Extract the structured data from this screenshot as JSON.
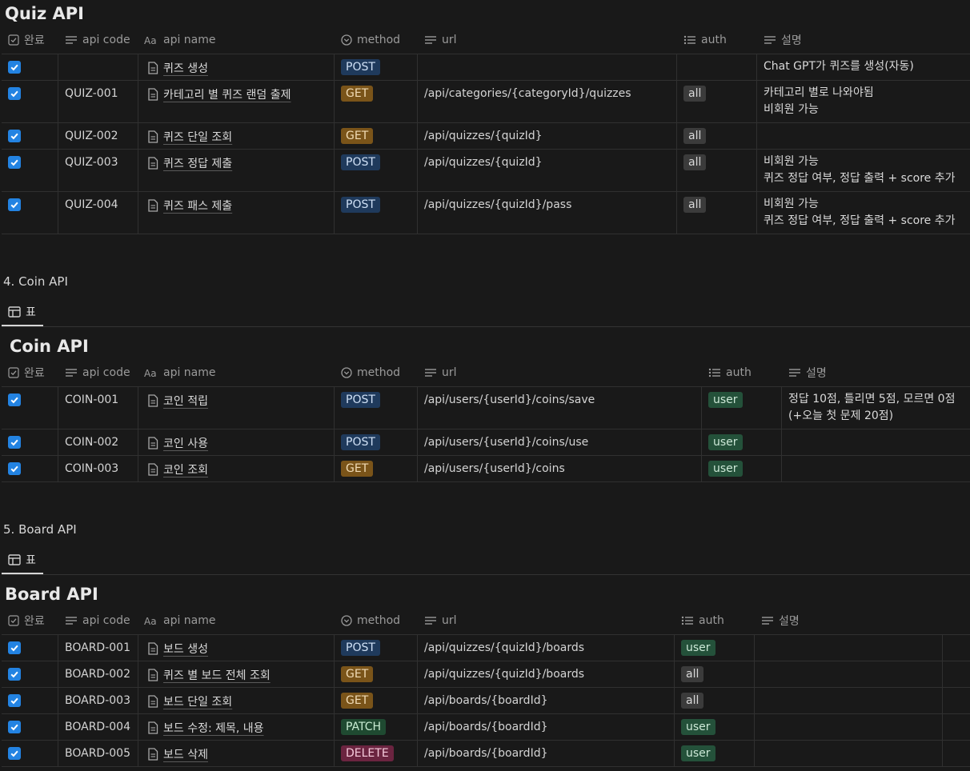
{
  "columns": {
    "done": "완료",
    "code": "api code",
    "name": "api name",
    "method": "method",
    "url": "url",
    "auth": "auth",
    "desc": "설명"
  },
  "view_tab_label": "표",
  "quiz": {
    "title": "Quiz API",
    "rows": [
      {
        "code": "",
        "name": "퀴즈 생성",
        "method": "POST",
        "url": "",
        "auth": "",
        "desc1": "Chat GPT가 퀴즈를 생성(자동)",
        "desc2": ""
      },
      {
        "code": "QUIZ-001",
        "name": "카테고리 별 퀴즈 랜덤 출제",
        "method": "GET",
        "url": "/api/categories/{categoryId}/quizzes",
        "auth": "all",
        "desc1": "카테고리 별로 나와야됨",
        "desc2": "비회원 가능"
      },
      {
        "code": "QUIZ-002",
        "name": "퀴즈 단일 조회",
        "method": "GET",
        "url": "/api/quizzes/{quizId}",
        "auth": "all",
        "desc1": "",
        "desc2": ""
      },
      {
        "code": "QUIZ-003",
        "name": "퀴즈 정답 제출",
        "method": "POST",
        "url": "/api/quizzes/{quizId}",
        "auth": "all",
        "desc1": "비회원 가능",
        "desc2": "퀴즈 정답 여부, 정답 출력 + score 추가"
      },
      {
        "code": "QUIZ-004",
        "name": "퀴즈 패스 제출",
        "method": "POST",
        "url": "/api/quizzes/{quizId}/pass",
        "auth": "all",
        "desc1": "비회원 가능",
        "desc2": "퀴즈 정답 여부, 정답 출력 + score 추가"
      }
    ]
  },
  "coin": {
    "heading": "4. Coin API",
    "title": "Coin API",
    "rows": [
      {
        "code": "COIN-001",
        "name": "코인 적립",
        "method": "POST",
        "url": "/api/users/{userId}/coins/save",
        "auth": "user",
        "desc1": "정답 10점, 틀리면 5점, 모르면 0점",
        "desc2": "(+오늘 첫 문제 20점)"
      },
      {
        "code": "COIN-002",
        "name": "코인 사용",
        "method": "POST",
        "url": "/api/users/{userId}/coins/use",
        "auth": "user",
        "desc1": "",
        "desc2": ""
      },
      {
        "code": "COIN-003",
        "name": "코인 조회",
        "method": "GET",
        "url": "/api/users/{userId}/coins",
        "auth": "user",
        "desc1": "",
        "desc2": ""
      }
    ]
  },
  "board": {
    "heading": "5. Board API",
    "title": "Board API",
    "rows": [
      {
        "code": "BOARD-001",
        "name": "보드 생성",
        "method": "POST",
        "url": "/api/quizzes/{quizId}/boards",
        "auth": "user"
      },
      {
        "code": "BOARD-002",
        "name": "퀴즈 별 보드 전체 조회",
        "method": "GET",
        "url": "/api/quizzes/{quizId}/boards",
        "auth": "all"
      },
      {
        "code": "BOARD-003",
        "name": "보드 단일 조회",
        "method": "GET",
        "url": "/api/boards/{boardId}",
        "auth": "all"
      },
      {
        "code": "BOARD-004",
        "name": "보드 수정: 제목, 내용",
        "method": "PATCH",
        "url": "/api/boards/{boardId}",
        "auth": "user"
      },
      {
        "code": "BOARD-005",
        "name": "보드 삭제",
        "method": "DELETE",
        "url": "/api/boards/{boardId}",
        "auth": "user"
      }
    ]
  },
  "colors": {
    "background": "#191919",
    "checkbox": "#2383e2",
    "post": "#1f3a5c",
    "get": "#7a5419",
    "patch": "#1f4a31",
    "delete": "#6b2440",
    "auth_all": "#3b3b3b",
    "auth_user": "#24513a"
  },
  "icons": {
    "done": "checkbox-icon",
    "text_prop": "text-lines-icon",
    "title_prop": "aa-title-icon",
    "select_prop": "select-circle-icon",
    "multi_select_prop": "list-icon",
    "page": "page-icon",
    "table_view": "table-icon",
    "check": "check-icon"
  }
}
